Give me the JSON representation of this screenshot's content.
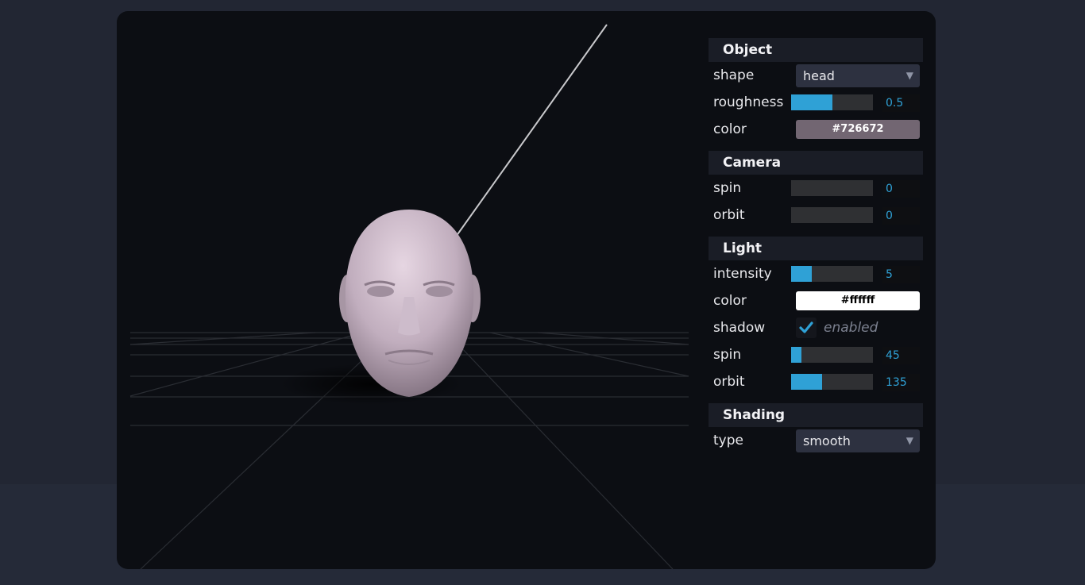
{
  "panel": {
    "object": {
      "title": "Object",
      "shape": {
        "label": "shape",
        "value": "head"
      },
      "roughness": {
        "label": "roughness",
        "value": "0.5",
        "fraction": 0.5
      },
      "color": {
        "label": "color",
        "value": "#726672",
        "hex": "#726672"
      }
    },
    "camera": {
      "title": "Camera",
      "spin": {
        "label": "spin",
        "value": "0",
        "fraction": 0
      },
      "orbit": {
        "label": "orbit",
        "value": "0",
        "fraction": 0
      }
    },
    "light": {
      "title": "Light",
      "intensity": {
        "label": "intensity",
        "value": "5",
        "fraction": 0.25
      },
      "color": {
        "label": "color",
        "value": "#ffffff",
        "hex": "#ffffff"
      },
      "shadow": {
        "label": "shadow",
        "checked": true,
        "text": "enabled"
      },
      "spin": {
        "label": "spin",
        "value": "45",
        "fraction": 0.125
      },
      "orbit": {
        "label": "orbit",
        "value": "135",
        "fraction": 0.375
      }
    },
    "shading": {
      "title": "Shading",
      "type": {
        "label": "type",
        "value": "smooth"
      }
    }
  },
  "colors": {
    "accent": "#2fa1d6",
    "object_color": "#726672",
    "light_color": "#ffffff",
    "head_skin": "#c9b7c6"
  },
  "icons": {
    "dropdown": "caret-down-icon",
    "checkbox": "check-icon"
  }
}
